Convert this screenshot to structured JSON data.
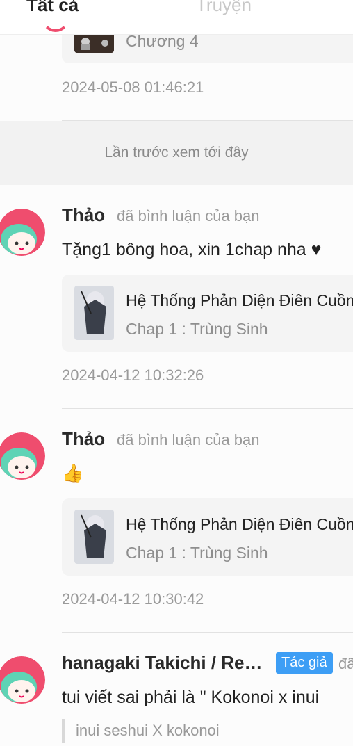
{
  "tabs": {
    "all": "Tất cả",
    "stories": "Truyện"
  },
  "top_item": {
    "chapter": "Chương 4",
    "timestamp": "2024-05-08 01:46:21"
  },
  "last_viewed_banner": "Lần trước xem tới đây",
  "comments": [
    {
      "user": "Thảo",
      "action": "đã bình luận của bạn",
      "text": "Tặng1 bông hoa, xin 1chap nha ♥",
      "card_title": "Hệ Thống Phản Diện Điên Cuồng",
      "card_subtitle": "Chap 1 : Trùng Sinh",
      "timestamp": "2024-04-12 10:32:26"
    },
    {
      "user": "Thảo",
      "action": "đã bình luận của bạn",
      "text": "👍",
      "card_title": "Hệ Thống Phản Diện Điên Cuồng",
      "card_subtitle": "Chap 1 : Trùng Sinh",
      "timestamp": "2024-04-12 10:30:42"
    },
    {
      "user": "hanagaki Takichi / Re…",
      "badge": "Tác giả",
      "action": "đã",
      "text": "tui viết sai phải là \" Kokonoi x inui",
      "quote": "inui seshui X kokonoi"
    }
  ],
  "colors": {
    "accent": "#ef4d6e",
    "badge": "#3d9ef5",
    "avatar_bg": "#ef4d6e",
    "avatar_hair": "#5fd3b5"
  }
}
